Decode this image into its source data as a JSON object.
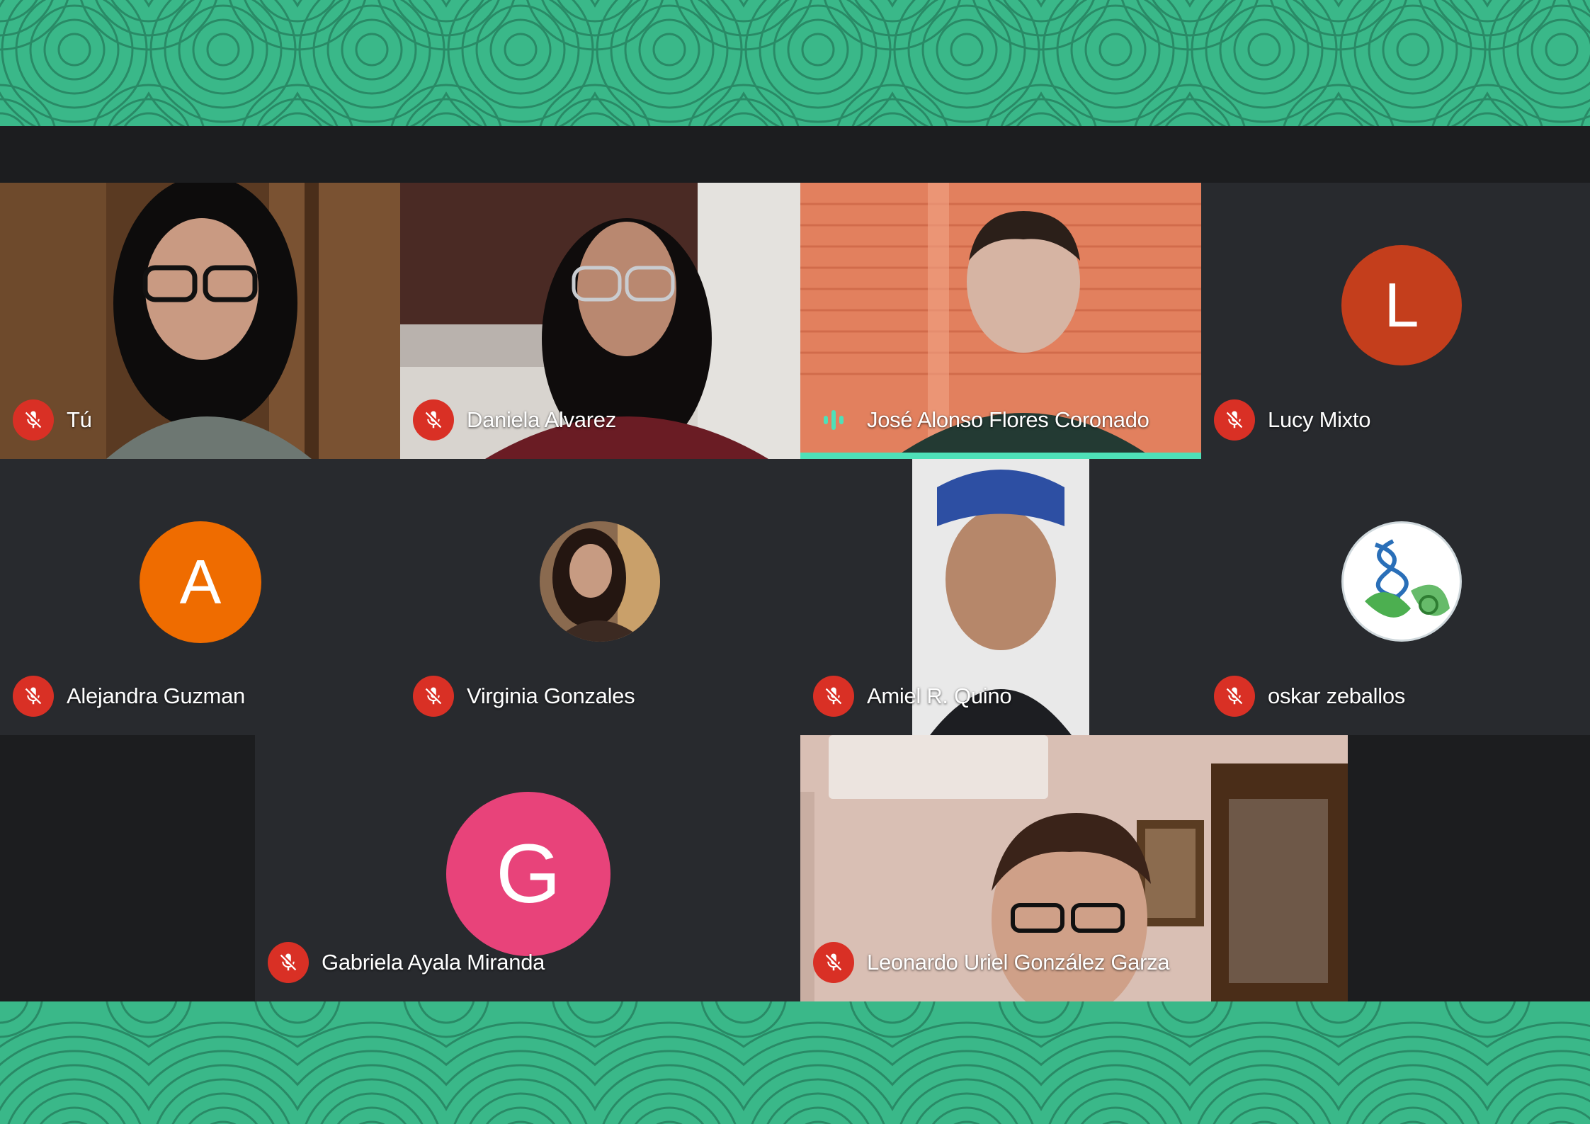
{
  "theme": {
    "background_green": "#3ab889",
    "pattern_line": "#227a5a",
    "tile_bg": "#282a2e",
    "stage_bg": "#1c1d1f",
    "mic_off_red": "#d93025",
    "speaking_accent": "#4ee0b8"
  },
  "participants": [
    {
      "name": "Tú",
      "mic": "muted",
      "camera": "on"
    },
    {
      "name": "Daniela Alvarez",
      "mic": "muted",
      "camera": "on"
    },
    {
      "name": "José Alonso Flores Coronado",
      "mic": "speaking",
      "camera": "on"
    },
    {
      "name": "Lucy Mixto",
      "mic": "muted",
      "camera": "off",
      "avatar_letter": "L",
      "avatar_color": "#c43e1c"
    },
    {
      "name": "Alejandra Guzman",
      "mic": "muted",
      "camera": "off",
      "avatar_letter": "A",
      "avatar_color": "#ef6c00"
    },
    {
      "name": "Virginia Gonzales",
      "mic": "muted",
      "camera": "off",
      "avatar_type": "profile-photo"
    },
    {
      "name": "Amiel R. Quino",
      "mic": "muted",
      "camera": "on"
    },
    {
      "name": "oskar zeballos",
      "mic": "muted",
      "camera": "off",
      "avatar_type": "logo-image"
    },
    {
      "name": "Gabriela Ayala Miranda",
      "mic": "muted",
      "camera": "off",
      "avatar_letter": "G",
      "avatar_color": "#e8437a"
    },
    {
      "name": "Leonardo Uriel González Garza",
      "mic": "muted",
      "camera": "on"
    }
  ],
  "icons": {
    "mic_off": "mic-off-icon",
    "speaking": "audio-level-icon"
  }
}
